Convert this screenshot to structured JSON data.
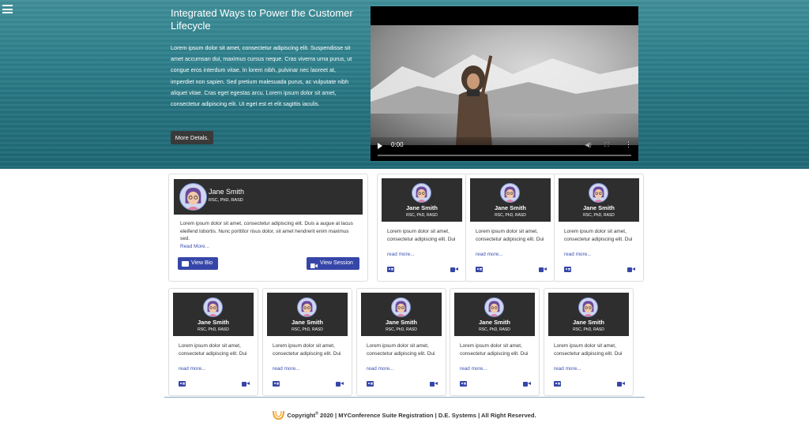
{
  "hero": {
    "title": "Integrated Ways to Power the Customer Lifecycle",
    "text": "Lorem ipsum dolor sit amet, consectetur adipiscing elit. Suspendisse sit amet accumsan dui, maximus cursus neque. Cras viverra urna purus, ut congue eros interdum vitae. In lorem nibh, pulvinar nec laoreet at, imperdiet non sapien. Sed pretium malesuada purus, ac vulputate nibh aliquet vitae. Cras eget egestas arcu. Lorem ipsum dolor sit amet, consectetur adipiscing elit. Ut eget est et elit sagittis iaculis.",
    "button": "More Detals."
  },
  "video": {
    "time": "0:00"
  },
  "featured": {
    "name": "Jane Smith",
    "credentials": "RSC, PhD, RASD",
    "description": "Lorem ipsum dolor sit amet, consectetur adipiscing elit. Duis a augue at lacus eleifend lobortis. Nunc porttitor risus dolor, sit amet hendrerit enim maximus sed.",
    "read_more": "Read More...",
    "view_bio": "View Bio",
    "view_session": "View Session"
  },
  "speakers": [
    {
      "name": "Jane Smith",
      "credentials": "RSC, PhD, RASD",
      "description": "Lorem ipsum dolor sit amet, consectetur adipiscing elit. Dui",
      "read_more": "read more..."
    },
    {
      "name": "Jane Smith",
      "credentials": "RSC, PhD, RASD",
      "description": "Lorem ipsum dolor sit amet, consectetur adipiscing elit. Dui",
      "read_more": "read more..."
    },
    {
      "name": "Jane Smith",
      "credentials": "RSC, PhD, RASD",
      "description": "Lorem ipsum dolor sit amet, consectetur adipiscing elit. Dui",
      "read_more": "read more..."
    },
    {
      "name": "Jane Smith",
      "credentials": "RSC, PhD, RASD",
      "description": "Lorem ipsum dolor sit amet, consectetur adipiscing elit. Dui",
      "read_more": "read more..."
    },
    {
      "name": "Jane Smith",
      "credentials": "RSC, PhD, RASD",
      "description": "Lorem ipsum dolor sit amet, consectetur adipiscing elit. Dui",
      "read_more": "read more..."
    },
    {
      "name": "Jane Smith",
      "credentials": "RSC, PhD, RASD",
      "description": "Lorem ipsum dolor sit amet, consectetur adipiscing elit. Dui",
      "read_more": "read more..."
    },
    {
      "name": "Jane Smith",
      "credentials": "RSC, PhD, RASD",
      "description": "Lorem ipsum dolor sit amet, consectetur adipiscing elit. Dui",
      "read_more": "read more..."
    },
    {
      "name": "Jane Smith",
      "credentials": "RSC, PhD, RASD",
      "description": "Lorem ipsum dolor sit amet, consectetur adipiscing elit. Dui",
      "read_more": "read more..."
    }
  ],
  "footer": {
    "copyright": "Copyright",
    "reg": "®",
    "rest": " 2020 | MYConference Suite Registration | D.E. Systems | All Right Reserved."
  },
  "colors": {
    "accent": "#3646a8",
    "card_head": "#2e2e2e",
    "link": "#3b4fae"
  }
}
